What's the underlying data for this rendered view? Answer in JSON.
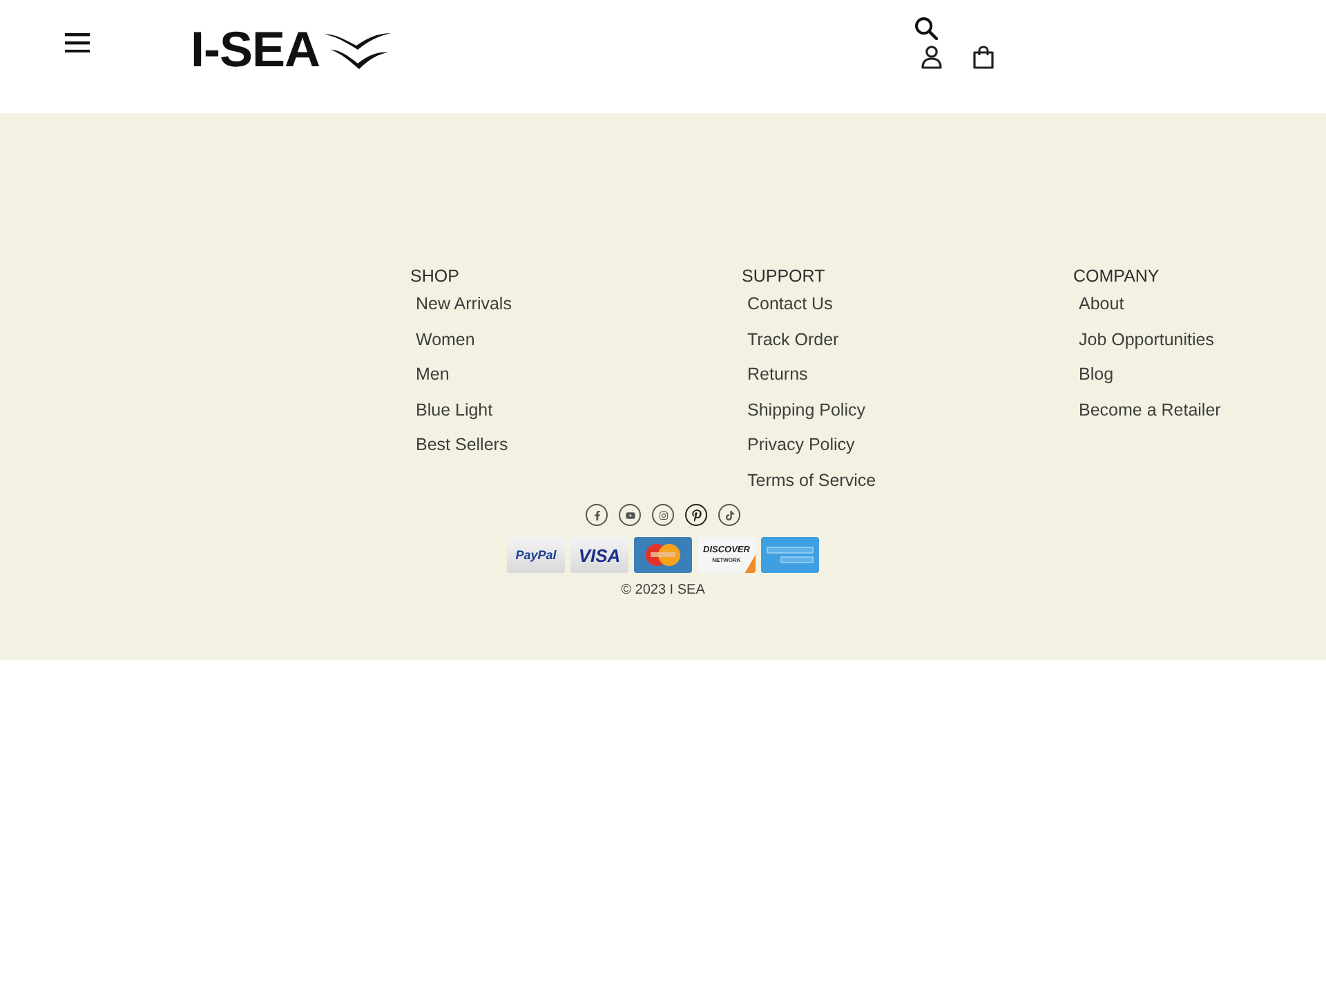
{
  "header": {
    "logo": {
      "text": "I-SEA"
    }
  },
  "footer": {
    "columns": [
      {
        "heading": "SHOP",
        "links": [
          "New Arrivals",
          "Women",
          "Men",
          "Blue Light",
          "Best Sellers"
        ]
      },
      {
        "heading": "SUPPORT",
        "links": [
          "Contact Us",
          "Track Order",
          "Returns",
          "Shipping Policy",
          "Privacy Policy",
          "Terms of Service"
        ]
      },
      {
        "heading": "COMPANY",
        "links": [
          "About",
          "Job Opportunities",
          "Blog",
          "Become a Retailer"
        ]
      }
    ],
    "social_links": [
      {
        "kind": "facebook"
      },
      {
        "kind": "youtube"
      },
      {
        "kind": "instagram"
      },
      {
        "kind": "pinterest"
      },
      {
        "kind": "tiktok"
      }
    ],
    "payment_cards": [
      {
        "kind": "paypal",
        "label": "PayPal"
      },
      {
        "kind": "visa",
        "label": "VISA"
      },
      {
        "kind": "mastercard"
      },
      {
        "kind": "discover",
        "label": "DISCOVER",
        "sublabel": "NETWORK"
      },
      {
        "kind": "amex"
      }
    ],
    "copyright": "© 2023 I SEA"
  }
}
